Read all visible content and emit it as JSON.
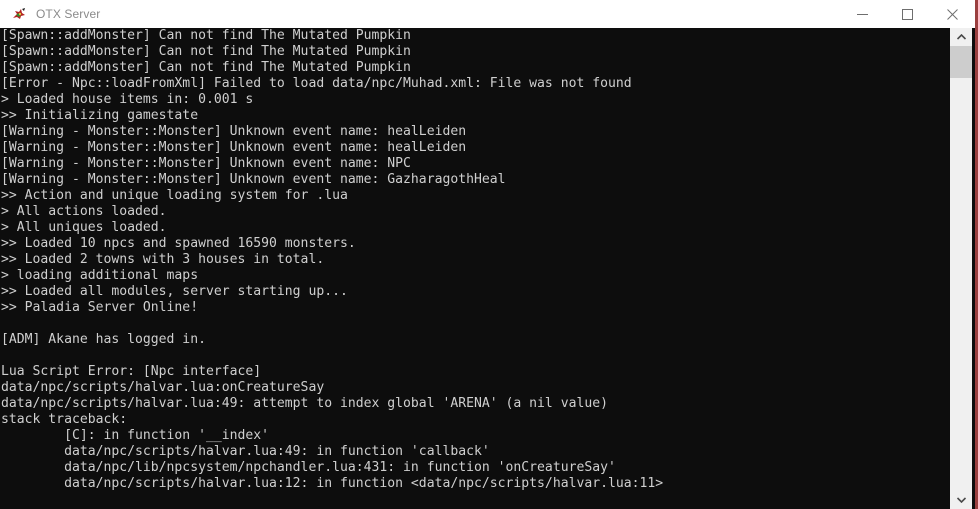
{
  "window": {
    "title": "OTX Server",
    "icon": "otx-server-icon",
    "accent_border_color": "#9b3f3f",
    "titlebar_background": "#ffffff",
    "console_background": "#0d0d0d",
    "console_text_color": "#cfcfcf"
  },
  "controls": {
    "minimize_label": "Minimize",
    "maximize_label": "Maximize",
    "close_label": "Close"
  },
  "scrollbar": {
    "up_arrow_label": "Scroll up",
    "down_arrow_label": "Scroll down",
    "thumb_label": "Scroll thumb"
  },
  "console": {
    "lines": [
      "[Spawn::addMonster] Can not find The Mutated Pumpkin",
      "[Spawn::addMonster] Can not find The Mutated Pumpkin",
      "[Spawn::addMonster] Can not find The Mutated Pumpkin",
      "[Error - Npc::loadFromXml] Failed to load data/npc/Muhad.xml: File was not found",
      "> Loaded house items in: 0.001 s",
      ">> Initializing gamestate",
      "[Warning - Monster::Monster] Unknown event name: healLeiden",
      "[Warning - Monster::Monster] Unknown event name: healLeiden",
      "[Warning - Monster::Monster] Unknown event name: NPC",
      "[Warning - Monster::Monster] Unknown event name: GazharagothHeal",
      ">> Action and unique loading system for .lua",
      "> All actions loaded.",
      "> All uniques loaded.",
      ">> Loaded 10 npcs and spawned 16590 monsters.",
      ">> Loaded 2 towns with 3 houses in total.",
      "> loading additional maps",
      ">> Loaded all modules, server starting up...",
      ">> Paladia Server Online!",
      "",
      "[ADM] Akane has logged in.",
      "",
      "Lua Script Error: [Npc interface]",
      "data/npc/scripts/halvar.lua:onCreatureSay",
      "data/npc/scripts/halvar.lua:49: attempt to index global 'ARENA' (a nil value)",
      "stack traceback:",
      "        [C]: in function '__index'",
      "        data/npc/scripts/halvar.lua:49: in function 'callback'",
      "        data/npc/lib/npcsystem/npchandler.lua:431: in function 'onCreatureSay'",
      "        data/npc/scripts/halvar.lua:12: in function <data/npc/scripts/halvar.lua:11>"
    ]
  }
}
